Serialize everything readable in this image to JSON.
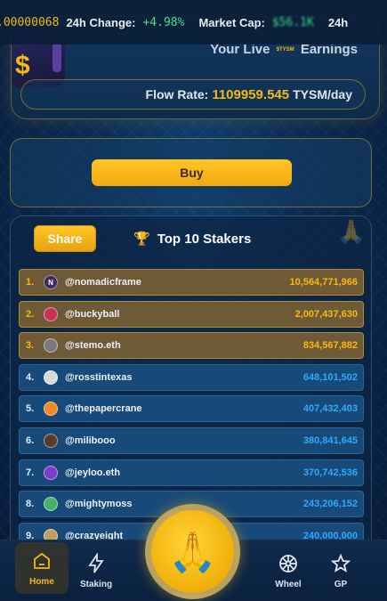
{
  "ticker": {
    "price": ".00000068",
    "change_label": "24h Change:",
    "change_value": "+4.98%",
    "mcap_label": "Market Cap:",
    "mcap_value": "$56.1K",
    "trail_label": "24h"
  },
  "earnings": {
    "label_prefix": "Your Live",
    "label_tiny": "$TYSM",
    "label_suffix": "Earnings",
    "flow_label": "Flow Rate:",
    "flow_value": "1109959.545",
    "flow_unit": "TYSM/day"
  },
  "buy": {
    "label": "Buy"
  },
  "stakers": {
    "share_label": "Share",
    "title": "Top 10 Stakers",
    "rows": [
      {
        "rank": "1.",
        "name": "@nomadicframe",
        "amount": "10,564,771,966",
        "tier": "gold",
        "avatar": "N",
        "avatar_color": "#3a2b5e"
      },
      {
        "rank": "2.",
        "name": "@buckyball",
        "amount": "2,007,437,630",
        "tier": "gold",
        "avatar": "",
        "avatar_color": "#c8325a"
      },
      {
        "rank": "3.",
        "name": "@stemo.eth",
        "amount": "834,567,882",
        "tier": "gold",
        "avatar": "",
        "avatar_color": "#7a7a7a"
      },
      {
        "rank": "4.",
        "name": "@rosstintexas",
        "amount": "648,101,502",
        "tier": "blue",
        "avatar": "",
        "avatar_color": "#d9d9d9"
      },
      {
        "rank": "5.",
        "name": "@thepapercrane",
        "amount": "407,432,403",
        "tier": "blue",
        "avatar": "",
        "avatar_color": "#f08a24"
      },
      {
        "rank": "6.",
        "name": "@milibooo",
        "amount": "380,841,645",
        "tier": "blue",
        "avatar": "",
        "avatar_color": "#5b3a2a"
      },
      {
        "rank": "7.",
        "name": "@jeyloo.eth",
        "amount": "370,742,536",
        "tier": "blue",
        "avatar": "",
        "avatar_color": "#7a3ec8"
      },
      {
        "rank": "8.",
        "name": "@mightymoss",
        "amount": "243,206,152",
        "tier": "blue",
        "avatar": "",
        "avatar_color": "#49b06a"
      },
      {
        "rank": "9.",
        "name": "@crazyeight",
        "amount": "240,000,000",
        "tier": "blue",
        "avatar": "",
        "avatar_color": "#c0a060"
      }
    ]
  },
  "nav": {
    "home": "Home",
    "staking": "Staking",
    "wheel": "Wheel",
    "gp": "GP"
  },
  "colors": {
    "accent": "#f5b915",
    "positive": "#3fe08a",
    "amount_blue": "#2fa9ff"
  },
  "icons": [
    "dollar-icon",
    "trophy-icon",
    "pray-hands-icon",
    "home-icon",
    "bolt-icon",
    "wheel-icon",
    "star-icon"
  ]
}
